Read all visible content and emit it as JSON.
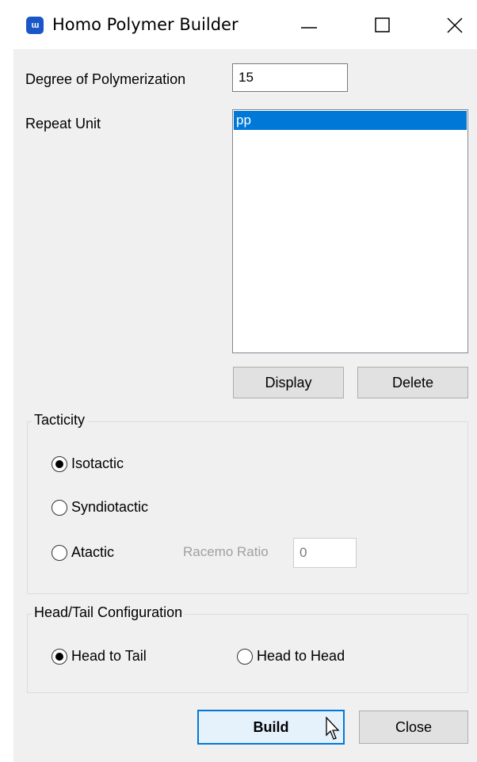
{
  "window": {
    "title": "Homo Polymer Builder",
    "icon": "app-logo-icon"
  },
  "degree": {
    "label": "Degree of Polymerization",
    "value": "15"
  },
  "repeat_unit": {
    "label": "Repeat Unit",
    "items": [
      "pp"
    ],
    "selected": "pp"
  },
  "buttons": {
    "display": "Display",
    "delete": "Delete",
    "build": "Build",
    "close": "Close"
  },
  "tacticity": {
    "title": "Tacticity",
    "options": [
      "Isotactic",
      "Syndiotactic",
      "Atactic"
    ],
    "selected": "Isotactic",
    "racemo_label": "Racemo Ratio",
    "racemo_value": "0"
  },
  "head_tail": {
    "title": "Head/Tail Configuration",
    "options": [
      "Head to Tail",
      "Head to Head"
    ],
    "selected": "Head to Tail"
  },
  "colors": {
    "selection": "#0078d7",
    "dialog_bg": "#f0f0f0",
    "icon_blue": "#1a56c6"
  }
}
